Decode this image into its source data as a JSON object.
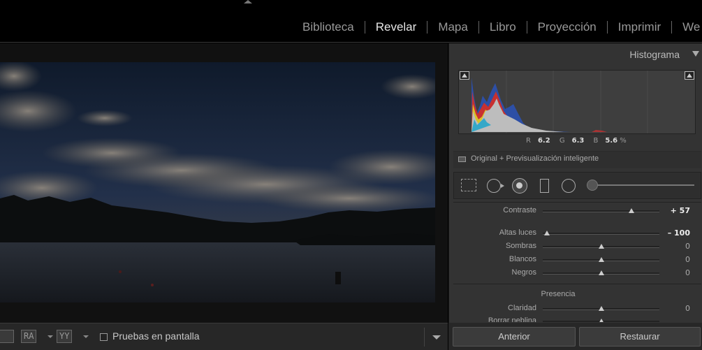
{
  "modules": [
    "Biblioteca",
    "Revelar",
    "Mapa",
    "Libro",
    "Proyección",
    "Imprimir",
    "We"
  ],
  "active_module": "Revelar",
  "toolbar": {
    "view_mode_1": "RA",
    "view_mode_2": "YY",
    "proof_label": "Pruebas en pantalla"
  },
  "histogram": {
    "title": "Histograma",
    "r_label": "R",
    "r_value": "6.2",
    "g_label": "G",
    "g_value": "6.3",
    "b_label": "B",
    "b_value": "5.6",
    "unit": "%",
    "preview_label": "Original + Previsualización inteligente"
  },
  "sliders": [
    {
      "label": "Contraste",
      "value": "+ 57",
      "level": 0.78,
      "strong": true
    },
    {
      "label": "Altas luces",
      "value": "– 100",
      "level": 0.0,
      "strong": true
    },
    {
      "label": "Sombras",
      "value": "0",
      "level": 0.5,
      "strong": false
    },
    {
      "label": "Blancos",
      "value": "0",
      "level": 0.5,
      "strong": false
    },
    {
      "label": "Negros",
      "value": "0",
      "level": 0.5,
      "strong": false
    },
    {
      "label": "Claridad",
      "value": "0",
      "level": 0.5,
      "strong": false
    },
    {
      "label": "Borrar neblina",
      "value": "",
      "level": 0.5,
      "strong": false
    }
  ],
  "section_presence": "Presencia",
  "buttons": {
    "previous": "Anterior",
    "reset": "Restaurar"
  }
}
